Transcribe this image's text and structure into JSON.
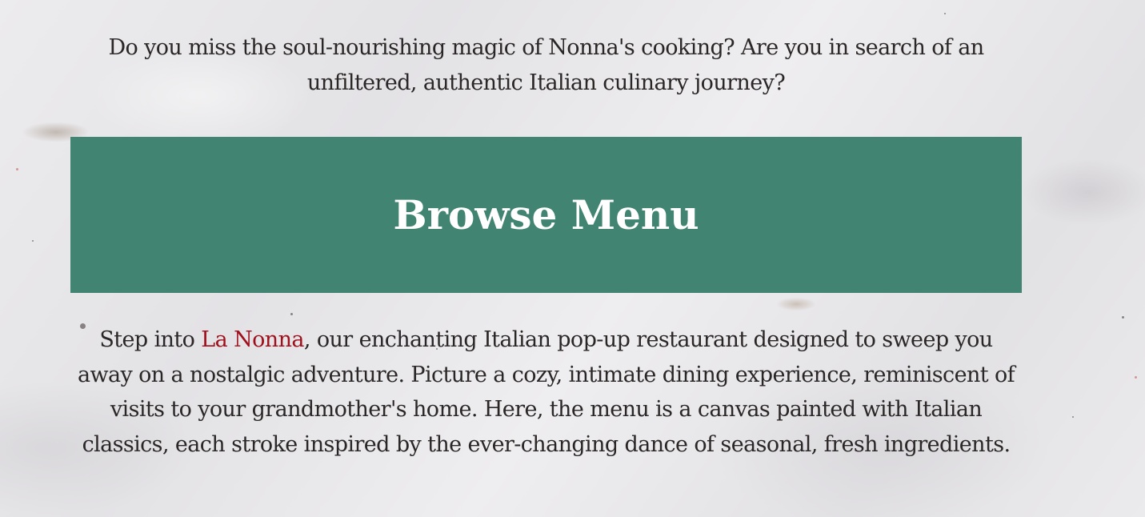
{
  "intro": {
    "text": "Do you miss the soul-nourishing magic of Nonna's cooking? Are you in search of an unfiltered, authentic Italian culinary journey?"
  },
  "cta": {
    "label": "Browse Menu"
  },
  "story": {
    "prefix": "Step into ",
    "brand": "La Nonna",
    "body": ", our enchanting Italian pop-up restaurant designed to sweep you away on a nostalgic adventure. Picture a cozy, intimate dining experience, reminiscent of visits to your grandmother's home. Here, the menu is a canvas painted with Italian classics, each stroke inspired by the ever-changing dance of seasonal, fresh ingredients."
  },
  "colors": {
    "button_background": "#418471",
    "button_text": "#ffffff",
    "brand_link": "#a0101c",
    "body_text": "#2b2727",
    "page_background": "#e9e8ea"
  }
}
